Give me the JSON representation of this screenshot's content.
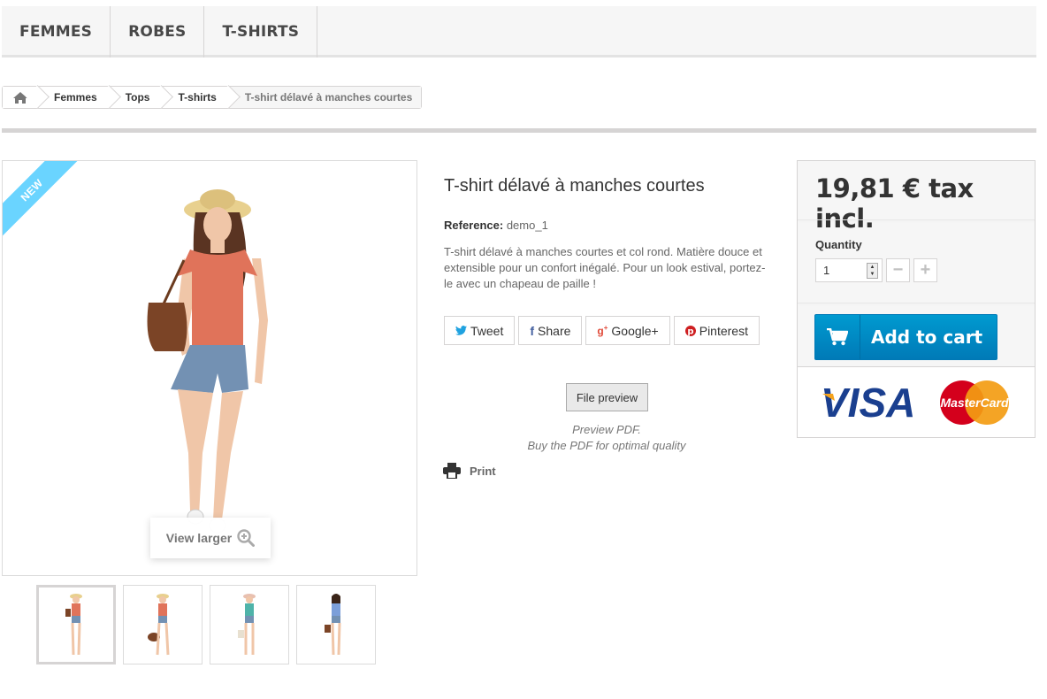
{
  "menu": {
    "items": [
      {
        "label": "FEMMES"
      },
      {
        "label": "ROBES"
      },
      {
        "label": "T-SHIRTS"
      }
    ]
  },
  "breadcrumb": {
    "home_icon": "home-icon",
    "items": [
      {
        "label": "Femmes"
      },
      {
        "label": "Tops"
      },
      {
        "label": "T-shirts"
      }
    ],
    "current": "T-shirt délavé à manches courtes"
  },
  "image": {
    "badge": "NEW",
    "view_larger": "View larger",
    "thumbnails_count": 4
  },
  "product": {
    "title": "T-shirt délavé à manches courtes",
    "reference_label": "Reference:",
    "reference_value": "demo_1",
    "description": "T-shirt délavé à manches courtes et col rond. Matière douce et extensible pour un confort inégalé. Pour un look estival, portez-le avec un chapeau de paille !"
  },
  "social": {
    "tweet": "Tweet",
    "share": "Share",
    "google": "Google+",
    "pinterest": "Pinterest"
  },
  "preview": {
    "button": "File preview",
    "line1": "Preview PDF.",
    "line2": "Buy the PDF for optimal quality"
  },
  "print_label": "Print",
  "buy_box": {
    "price": "19,81 € tax incl.",
    "quantity_label": "Quantity",
    "quantity_value": "1",
    "add_to_cart": "Add to cart",
    "payment": {
      "visa": "VISA",
      "mastercard": "MasterCard"
    }
  },
  "colors": {
    "accent_blue": "#0094cf",
    "ribbon": "#6ad4ff",
    "top_orange": "#e0735a",
    "shorts_blue": "#7391b3"
  }
}
